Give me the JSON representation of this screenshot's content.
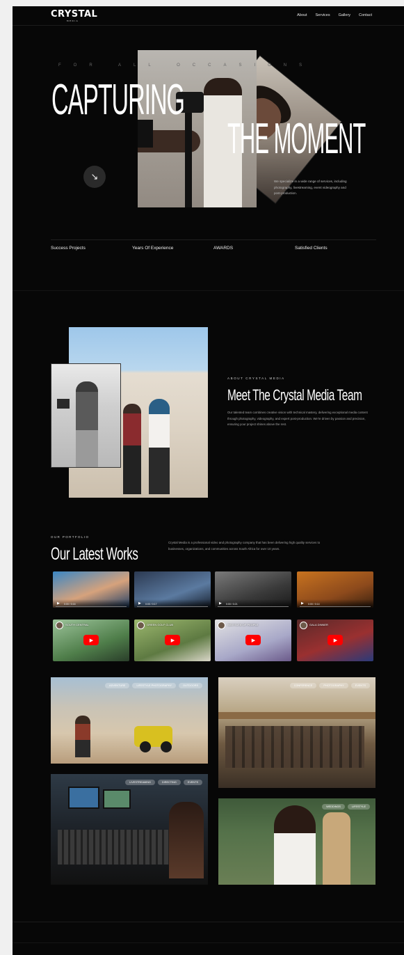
{
  "nav": {
    "logo": "CRYSTAL",
    "logo_sub": "MEDIA",
    "links": [
      "About",
      "Services",
      "Gallery",
      "Contact"
    ]
  },
  "hero": {
    "tagline": "FOR ALL OCCASIONS",
    "headline_1": "CAPTURING",
    "headline_2": "THE MOMENT",
    "description": "We specialize in a wide range of services, including photography, livestreaming, event videography and post-production."
  },
  "stats": [
    "Success Projects",
    "Years Of Experience",
    "AWARDS",
    "Satisfied Clients"
  ],
  "about": {
    "label": "ABOUT CRYSTAL MEDIA",
    "title": "Meet The Crystal Media Team",
    "text": "Our talented team combines creative vision with technical mastery, delivering exceptional media content through photography, videography, and expert post-production. We're driven by passion and precision, ensuring your project shines above the rest."
  },
  "portfolio": {
    "label": "OUR PORTFOLIO",
    "title": "Our Latest Works",
    "description": "Crystal Media is a professional video and photography company that has been delivering high quality services to businesses, organizations, and communities across South Africa for over 10 years."
  },
  "videos": [
    {
      "time": "0:00 / 0:16",
      "bg": "#2a6fa8"
    },
    {
      "time": "0:00 / 0:17",
      "bg": "#3a4b66"
    },
    {
      "time": "0:00 / 0:21",
      "bg": "#4a4a4a"
    },
    {
      "time": "0:00 / 0:14",
      "bg": "#b86a1c"
    }
  ],
  "youtube": [
    {
      "title": "SOUTH CENTRAL",
      "bg": "#6aa06a"
    },
    {
      "title": "GREEN GOLF CLUB",
      "bg": "#5a7a4a"
    },
    {
      "title": "INSTITUTE OF PEOPLE",
      "bg": "#c3c3c3"
    },
    {
      "title": "GALA DINNER",
      "bg": "#8a2a2a"
    }
  ],
  "gallery": [
    {
      "tags": [
        "ADVENTURE",
        "LIFESTYLE PHOTOGRAPHY",
        "OUTDOORS"
      ]
    },
    {
      "tags": [
        "CONFERENCE",
        "PHOTOGRAPHY",
        "EVENTS"
      ]
    },
    {
      "tags": [
        "LIVESTREAMING",
        "DIRECTING",
        "EVENTS"
      ]
    },
    {
      "tags": [
        "WEDDINGS",
        "LIFESTYLE"
      ]
    }
  ]
}
